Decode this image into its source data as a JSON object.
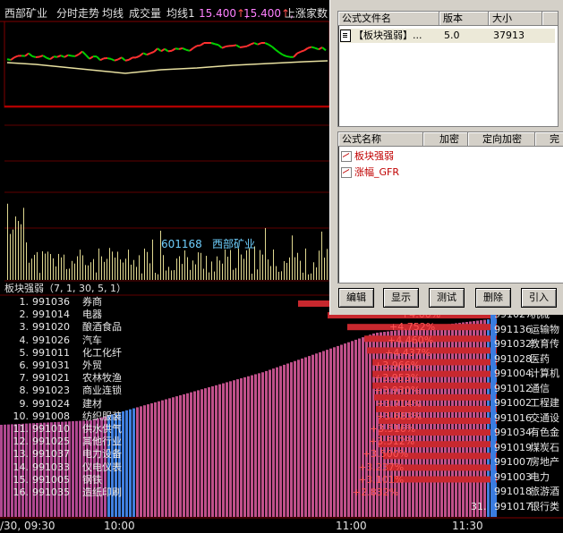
{
  "header": {
    "stock": "西部矿业",
    "mode": "分时走势",
    "avg_label": "均线",
    "volume_label": "成交量",
    "avg1_label": "均线1",
    "price1": "15.400",
    "price2": "15.400",
    "market_label": "上涨家数"
  },
  "volume_label": {
    "code": "601168",
    "name": "西部矿业"
  },
  "indicator_title": "板块强弱（7, 1, 30, 5, 1）",
  "rankings_left": [
    {
      "n": "1.",
      "code": "991036",
      "name": "券商",
      "pct": ""
    },
    {
      "n": "2.",
      "code": "991014",
      "name": "电器",
      "pct": "+4.00%"
    },
    {
      "n": "3.",
      "code": "991020",
      "name": "酿酒食品",
      "pct": "+4.752%"
    },
    {
      "n": "4.",
      "code": "991026",
      "name": "汽车",
      "pct": "+4.460%"
    },
    {
      "n": "5.",
      "code": "991011",
      "name": "化工化纤",
      "pct": "+4.437%"
    },
    {
      "n": "6.",
      "code": "991031",
      "name": "外贸",
      "pct": "+3.966%"
    },
    {
      "n": "7.",
      "code": "991021",
      "name": "农林牧渔",
      "pct": "+3.953%"
    },
    {
      "n": "8.",
      "code": "991023",
      "name": "商业连锁",
      "pct": "+3.930%"
    },
    {
      "n": "9.",
      "code": "991024",
      "name": "建材",
      "pct": "+3.714%"
    },
    {
      "n": "10.",
      "code": "991008",
      "name": "纺织服装",
      "pct": "+3.683%"
    },
    {
      "n": "11.",
      "code": "991010",
      "name": "供水供气",
      "pct": "+3.516%"
    },
    {
      "n": "12.",
      "code": "991025",
      "name": "其他行业",
      "pct": "+3.512%"
    },
    {
      "n": "13.",
      "code": "991037",
      "name": "电力设备",
      "pct": "+3.500%"
    },
    {
      "n": "14.",
      "code": "991033",
      "name": "仪电仪表",
      "pct": "+3.237%"
    },
    {
      "n": "15.",
      "code": "991005",
      "name": "钢铁",
      "pct": "+3.101%"
    },
    {
      "n": "16.",
      "code": "991035",
      "name": "造纸印刷",
      "pct": "+2.832%"
    }
  ],
  "rankings_right": [
    {
      "n": "",
      "code": "991027",
      "name": "机械"
    },
    {
      "n": "",
      "code": "991136",
      "name": "运输物"
    },
    {
      "n": "",
      "code": "991032",
      "name": "教育传"
    },
    {
      "n": "",
      "code": "991028",
      "name": "医药"
    },
    {
      "n": "",
      "code": "991004",
      "name": "计算机"
    },
    {
      "n": "",
      "code": "991012",
      "name": "通信"
    },
    {
      "n": "",
      "code": "991002",
      "name": "工程建"
    },
    {
      "n": "",
      "code": "991016",
      "name": "交通设"
    },
    {
      "n": "",
      "code": "991034",
      "name": "有色金"
    },
    {
      "n": "",
      "code": "991019",
      "name": "煤炭石"
    },
    {
      "n": "",
      "code": "991007",
      "name": "房地产"
    },
    {
      "n": "",
      "code": "991003",
      "name": "电力"
    },
    {
      "n": "",
      "code": "991018",
      "name": "旅游酒"
    },
    {
      "n": "31.",
      "code": "991017",
      "name": "银行类"
    }
  ],
  "time_axis": {
    "t0": "/30, 09:30",
    "t1": "10:00",
    "t2": "11:00",
    "t3": "11:30"
  },
  "dialog": {
    "files_header": {
      "name": "公式文件名",
      "version": "版本",
      "size": "大小"
    },
    "file": {
      "name": "【板块强弱】...",
      "version": "5.0",
      "size": "37913"
    },
    "formula_header": {
      "name": "公式名称",
      "encrypted": "加密",
      "fixed": "定向加密",
      "complete": "完"
    },
    "formulas": [
      "板块强弱",
      "涨幅_GFR"
    ],
    "buttons": {
      "edit": "编辑",
      "show": "显示",
      "test": "测试",
      "delete": "删除",
      "import": "引入"
    }
  },
  "colors": {
    "up": "#ff3030",
    "down": "#00d000",
    "grid": "#800000",
    "avg_line": "#ffff80"
  }
}
